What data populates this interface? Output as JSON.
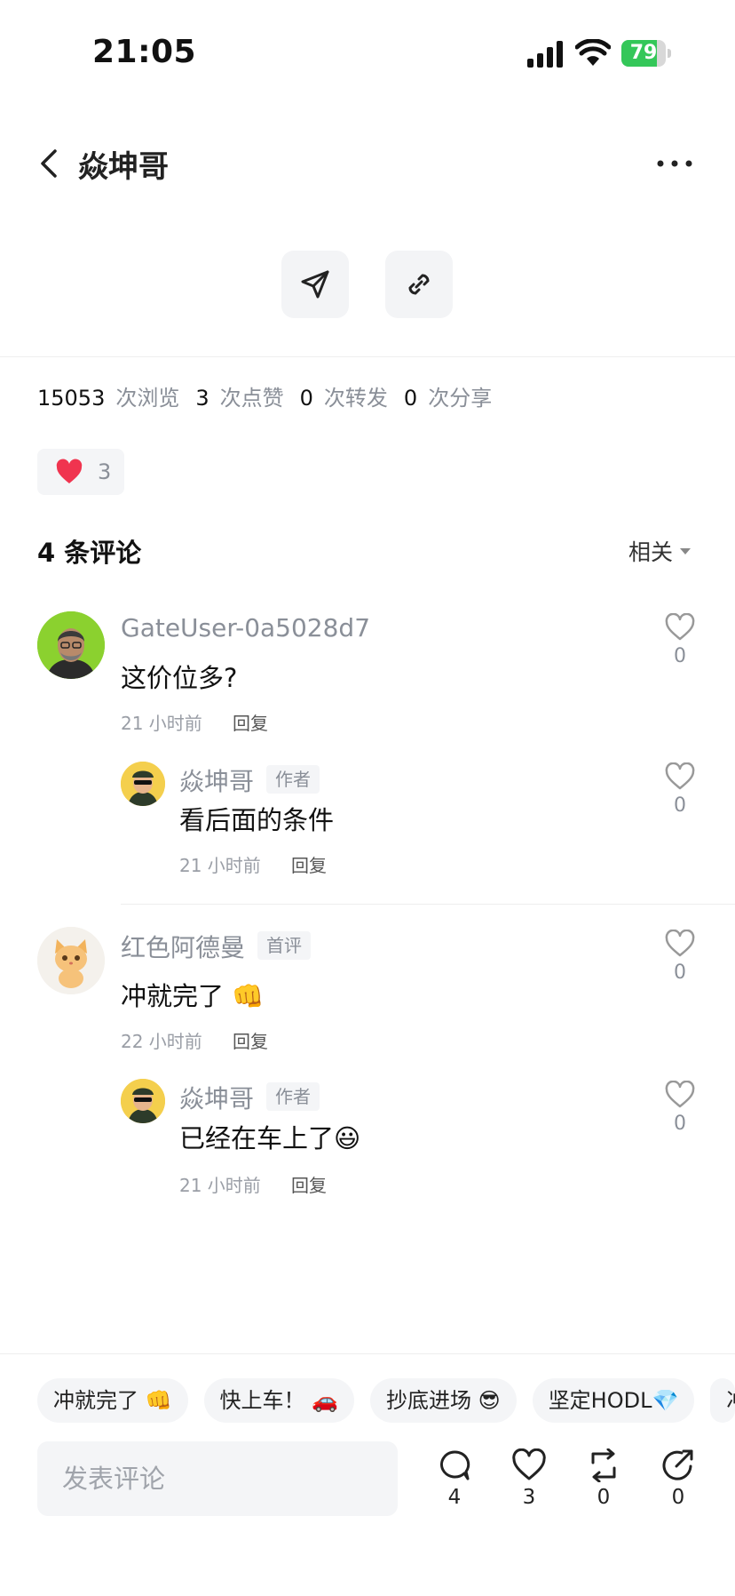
{
  "status_bar": {
    "time": "21:05",
    "battery": "79",
    "battery_level": 0.79
  },
  "header": {
    "title": "焱坤哥"
  },
  "stats": [
    {
      "value": "15053",
      "label": "次浏览"
    },
    {
      "value": "3",
      "label": "次点赞"
    },
    {
      "value": "0",
      "label": "次转发"
    },
    {
      "value": "0",
      "label": "次分享"
    }
  ],
  "reactions": {
    "heart_count": "3"
  },
  "comments_section": {
    "title": "4 条评论",
    "sort_label": "相关"
  },
  "comments": [
    {
      "user": "GateUser-0a5028d7",
      "text": "这价位多?",
      "time": "21 小时前",
      "reply": "回复",
      "likes": "0"
    },
    {
      "user": "焱坤哥",
      "tag": "作者",
      "text": "看后面的条件",
      "time": "21 小时前",
      "reply": "回复",
      "likes": "0"
    },
    {
      "user": "红色阿德曼",
      "tag": "首评",
      "text": "冲就完了 👊",
      "time": "22 小时前",
      "reply": "回复",
      "likes": "0"
    },
    {
      "user": "焱坤哥",
      "tag": "作者",
      "text": "已经在车上了😃",
      "time": "21 小时前",
      "reply": "回复",
      "likes": "0"
    }
  ],
  "quick_replies": [
    "冲就完了 👊",
    "快上车！ 🚗",
    "抄底进场 😎",
    "坚定HODL💎",
    "冲"
  ],
  "bottom_bar": {
    "input_placeholder": "发表评论",
    "comment_count": "4",
    "like_count": "3",
    "repost_count": "0",
    "share_count": "0"
  },
  "colors": {
    "heart": "#f0344f",
    "battery": "#34c759",
    "muted": "#8a8f98"
  }
}
